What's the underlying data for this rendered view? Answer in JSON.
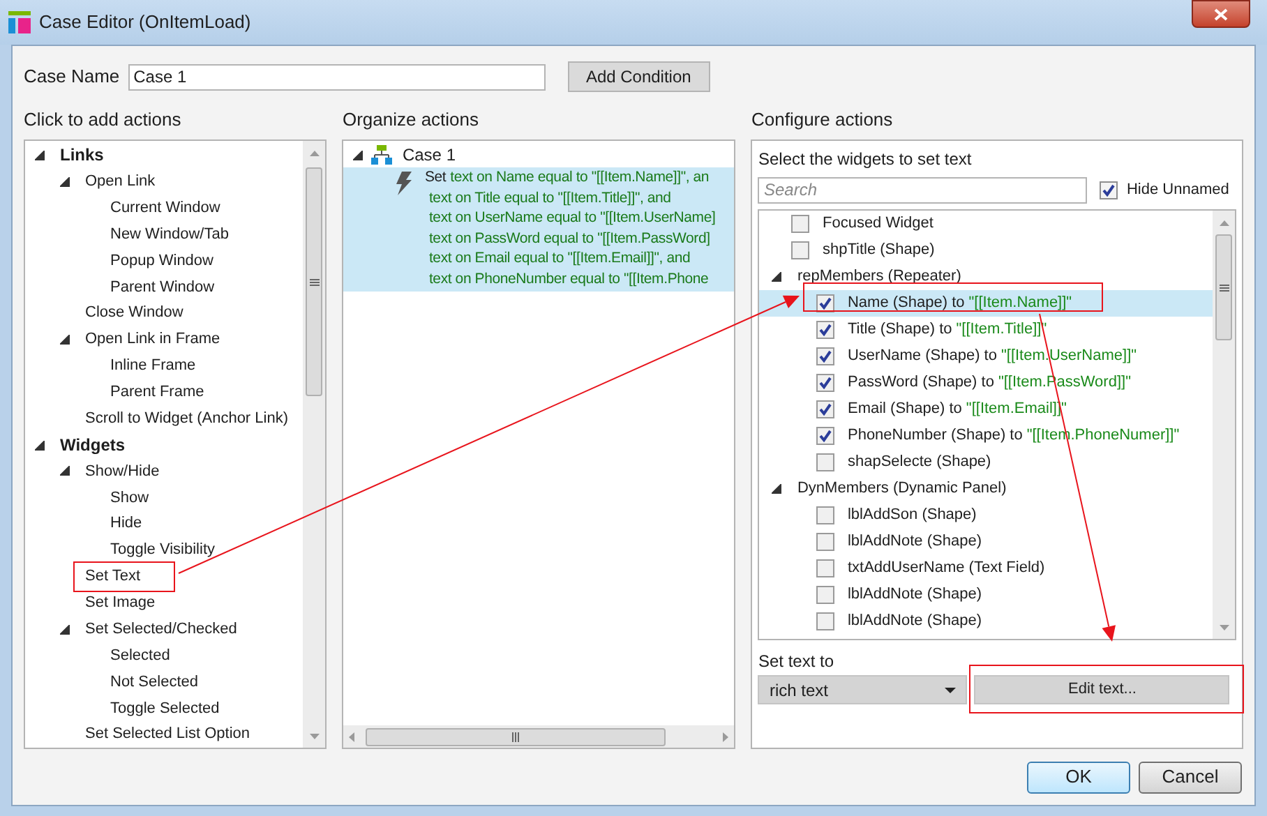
{
  "window": {
    "title": "Case Editor (OnItemLoad)"
  },
  "case_name": {
    "label": "Case Name",
    "value": "Case 1"
  },
  "add_condition_button": "Add Condition",
  "add_actions": {
    "heading": "Click to add actions",
    "items": [
      {
        "label": "Links",
        "expanded": true,
        "children": [
          {
            "label": "Open Link",
            "expanded": true,
            "children": [
              {
                "label": "Current Window"
              },
              {
                "label": "New Window/Tab"
              },
              {
                "label": "Popup Window"
              },
              {
                "label": "Parent Window"
              }
            ]
          },
          {
            "label": "Close Window"
          },
          {
            "label": "Open Link in Frame",
            "expanded": true,
            "children": [
              {
                "label": "Inline Frame"
              },
              {
                "label": "Parent Frame"
              }
            ]
          },
          {
            "label": "Scroll to Widget (Anchor Link)"
          }
        ]
      },
      {
        "label": "Widgets",
        "expanded": true,
        "children": [
          {
            "label": "Show/Hide",
            "expanded": true,
            "children": [
              {
                "label": "Show"
              },
              {
                "label": "Hide"
              },
              {
                "label": "Toggle Visibility"
              }
            ]
          },
          {
            "label": "Set Text"
          },
          {
            "label": "Set Image"
          },
          {
            "label": "Set Selected/Checked",
            "expanded": true,
            "children": [
              {
                "label": "Selected"
              },
              {
                "label": "Not Selected"
              },
              {
                "label": "Toggle Selected"
              }
            ]
          },
          {
            "label": "Set Selected List Option"
          }
        ]
      }
    ]
  },
  "organize_actions": {
    "heading": "Organize actions",
    "case": {
      "label": "Case 1",
      "expanded": true,
      "action": {
        "verb": "Set",
        "selected": true,
        "lines": [
          "text on Name equal to \"[[Item.Name]]\", an",
          "text on Title equal to \"[[Item.Title]]\", and",
          "text on UserName equal to \"[[Item.UserName]",
          "text on PassWord equal to \"[[Item.PassWord]",
          "text on Email equal to \"[[Item.Email]]\", and",
          "text on PhoneNumber equal to \"[[Item.Phone"
        ]
      }
    }
  },
  "configure_actions": {
    "heading": "Configure actions",
    "subheading": "Select the widgets to set text",
    "search": {
      "placeholder": "Search"
    },
    "hide_unnamed": {
      "label": "Hide Unnamed",
      "checked": true
    },
    "widgets": [
      {
        "kind": "checkbox",
        "label": "Focused Widget",
        "checked": false,
        "selected": false
      },
      {
        "kind": "checkbox",
        "label": "shpTitle (Shape)",
        "checked": false,
        "selected": false
      },
      {
        "kind": "group",
        "label": "repMembers (Repeater)",
        "expanded": true,
        "children": [
          {
            "kind": "checkbox",
            "label": "Name (Shape) to",
            "value": "\"[[Item.Name]]\"",
            "checked": true,
            "selected": true
          },
          {
            "kind": "checkbox",
            "label": "Title (Shape) to",
            "value": "\"[[Item.Title]]\"",
            "checked": true,
            "selected": false
          },
          {
            "kind": "checkbox",
            "label": "UserName (Shape) to",
            "value": "\"[[Item.UserName]]\"",
            "checked": true,
            "selected": false
          },
          {
            "kind": "checkbox",
            "label": "PassWord (Shape) to",
            "value": "\"[[Item.PassWord]]\"",
            "checked": true,
            "selected": false
          },
          {
            "kind": "checkbox",
            "label": "Email (Shape) to",
            "value": "\"[[Item.Email]]\"",
            "checked": true,
            "selected": false
          },
          {
            "kind": "checkbox",
            "label": "PhoneNumber (Shape) to",
            "value": "\"[[Item.PhoneNumer]]\"",
            "checked": true,
            "selected": false
          },
          {
            "kind": "checkbox",
            "label": "shapSelecte (Shape)",
            "checked": false,
            "selected": false
          }
        ]
      },
      {
        "kind": "group",
        "label": "DynMembers (Dynamic Panel)",
        "expanded": true,
        "children": [
          {
            "kind": "checkbox",
            "label": "lblAddSon (Shape)",
            "checked": false,
            "selected": false
          },
          {
            "kind": "checkbox",
            "label": "lblAddNote (Shape)",
            "checked": false,
            "selected": false
          },
          {
            "kind": "checkbox",
            "label": "txtAddUserName (Text Field)",
            "checked": false,
            "selected": false
          },
          {
            "kind": "checkbox",
            "label": "lblAddNote (Shape)",
            "checked": false,
            "selected": false
          },
          {
            "kind": "checkbox",
            "label": "lblAddNote (Shape)",
            "checked": false,
            "selected": false
          }
        ]
      }
    ],
    "set_text_to": {
      "label": "Set text to",
      "value": "rich text",
      "edit_button": "Edit text..."
    }
  },
  "buttons": [
    {
      "kind": "ok",
      "label": "OK"
    },
    {
      "kind": "cancel",
      "label": "Cancel"
    }
  ],
  "annotations": [
    {
      "kind": "box"
    },
    {
      "kind": "arrow"
    },
    {
      "kind": "box"
    },
    {
      "kind": "arrow"
    },
    {
      "kind": "box"
    }
  ]
}
